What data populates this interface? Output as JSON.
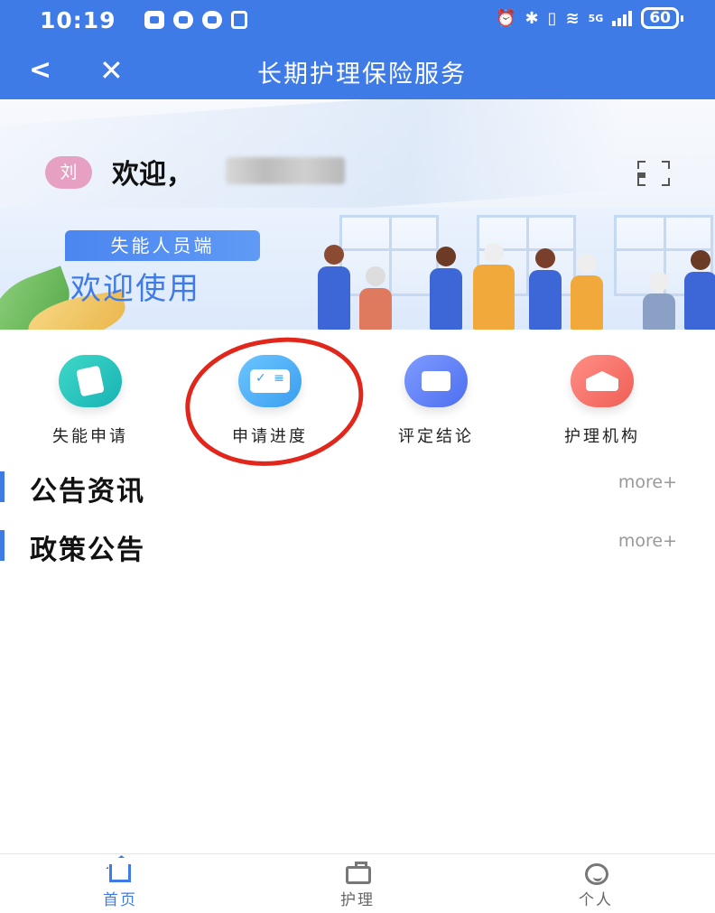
{
  "status_bar": {
    "time": "10:19",
    "network": "5G",
    "battery": "60"
  },
  "title_bar": {
    "back_icon": "chevron-left-icon",
    "close_icon": "close-icon",
    "title": "长期护理保险服务"
  },
  "header": {
    "avatar_text": "刘",
    "welcome_text": "欢迎，",
    "scan_icon": "scan-icon"
  },
  "banner": {
    "tag": "失能人员端",
    "headline": "欢迎使用"
  },
  "actions": [
    {
      "label": "失能申请",
      "icon": "hand-phone-icon",
      "color": "#1fbfba"
    },
    {
      "label": "申请进度",
      "icon": "checklist-card-icon",
      "color": "#47a8f2"
    },
    {
      "label": "评定结论",
      "icon": "document-tray-icon",
      "color": "#5a78f2"
    },
    {
      "label": "护理机构",
      "icon": "building-icon",
      "color": "#f06860"
    }
  ],
  "sections": [
    {
      "title": "公告资讯",
      "more": "more+"
    },
    {
      "title": "政策公告",
      "more": "more+"
    }
  ],
  "tabbar": [
    {
      "label": "首页",
      "icon": "home-icon",
      "active": true
    },
    {
      "label": "护理",
      "icon": "briefcase-icon",
      "active": false
    },
    {
      "label": "个人",
      "icon": "face-icon",
      "active": false
    }
  ],
  "colors": {
    "primary": "#3f7be6",
    "annotation": "#e1261c"
  }
}
